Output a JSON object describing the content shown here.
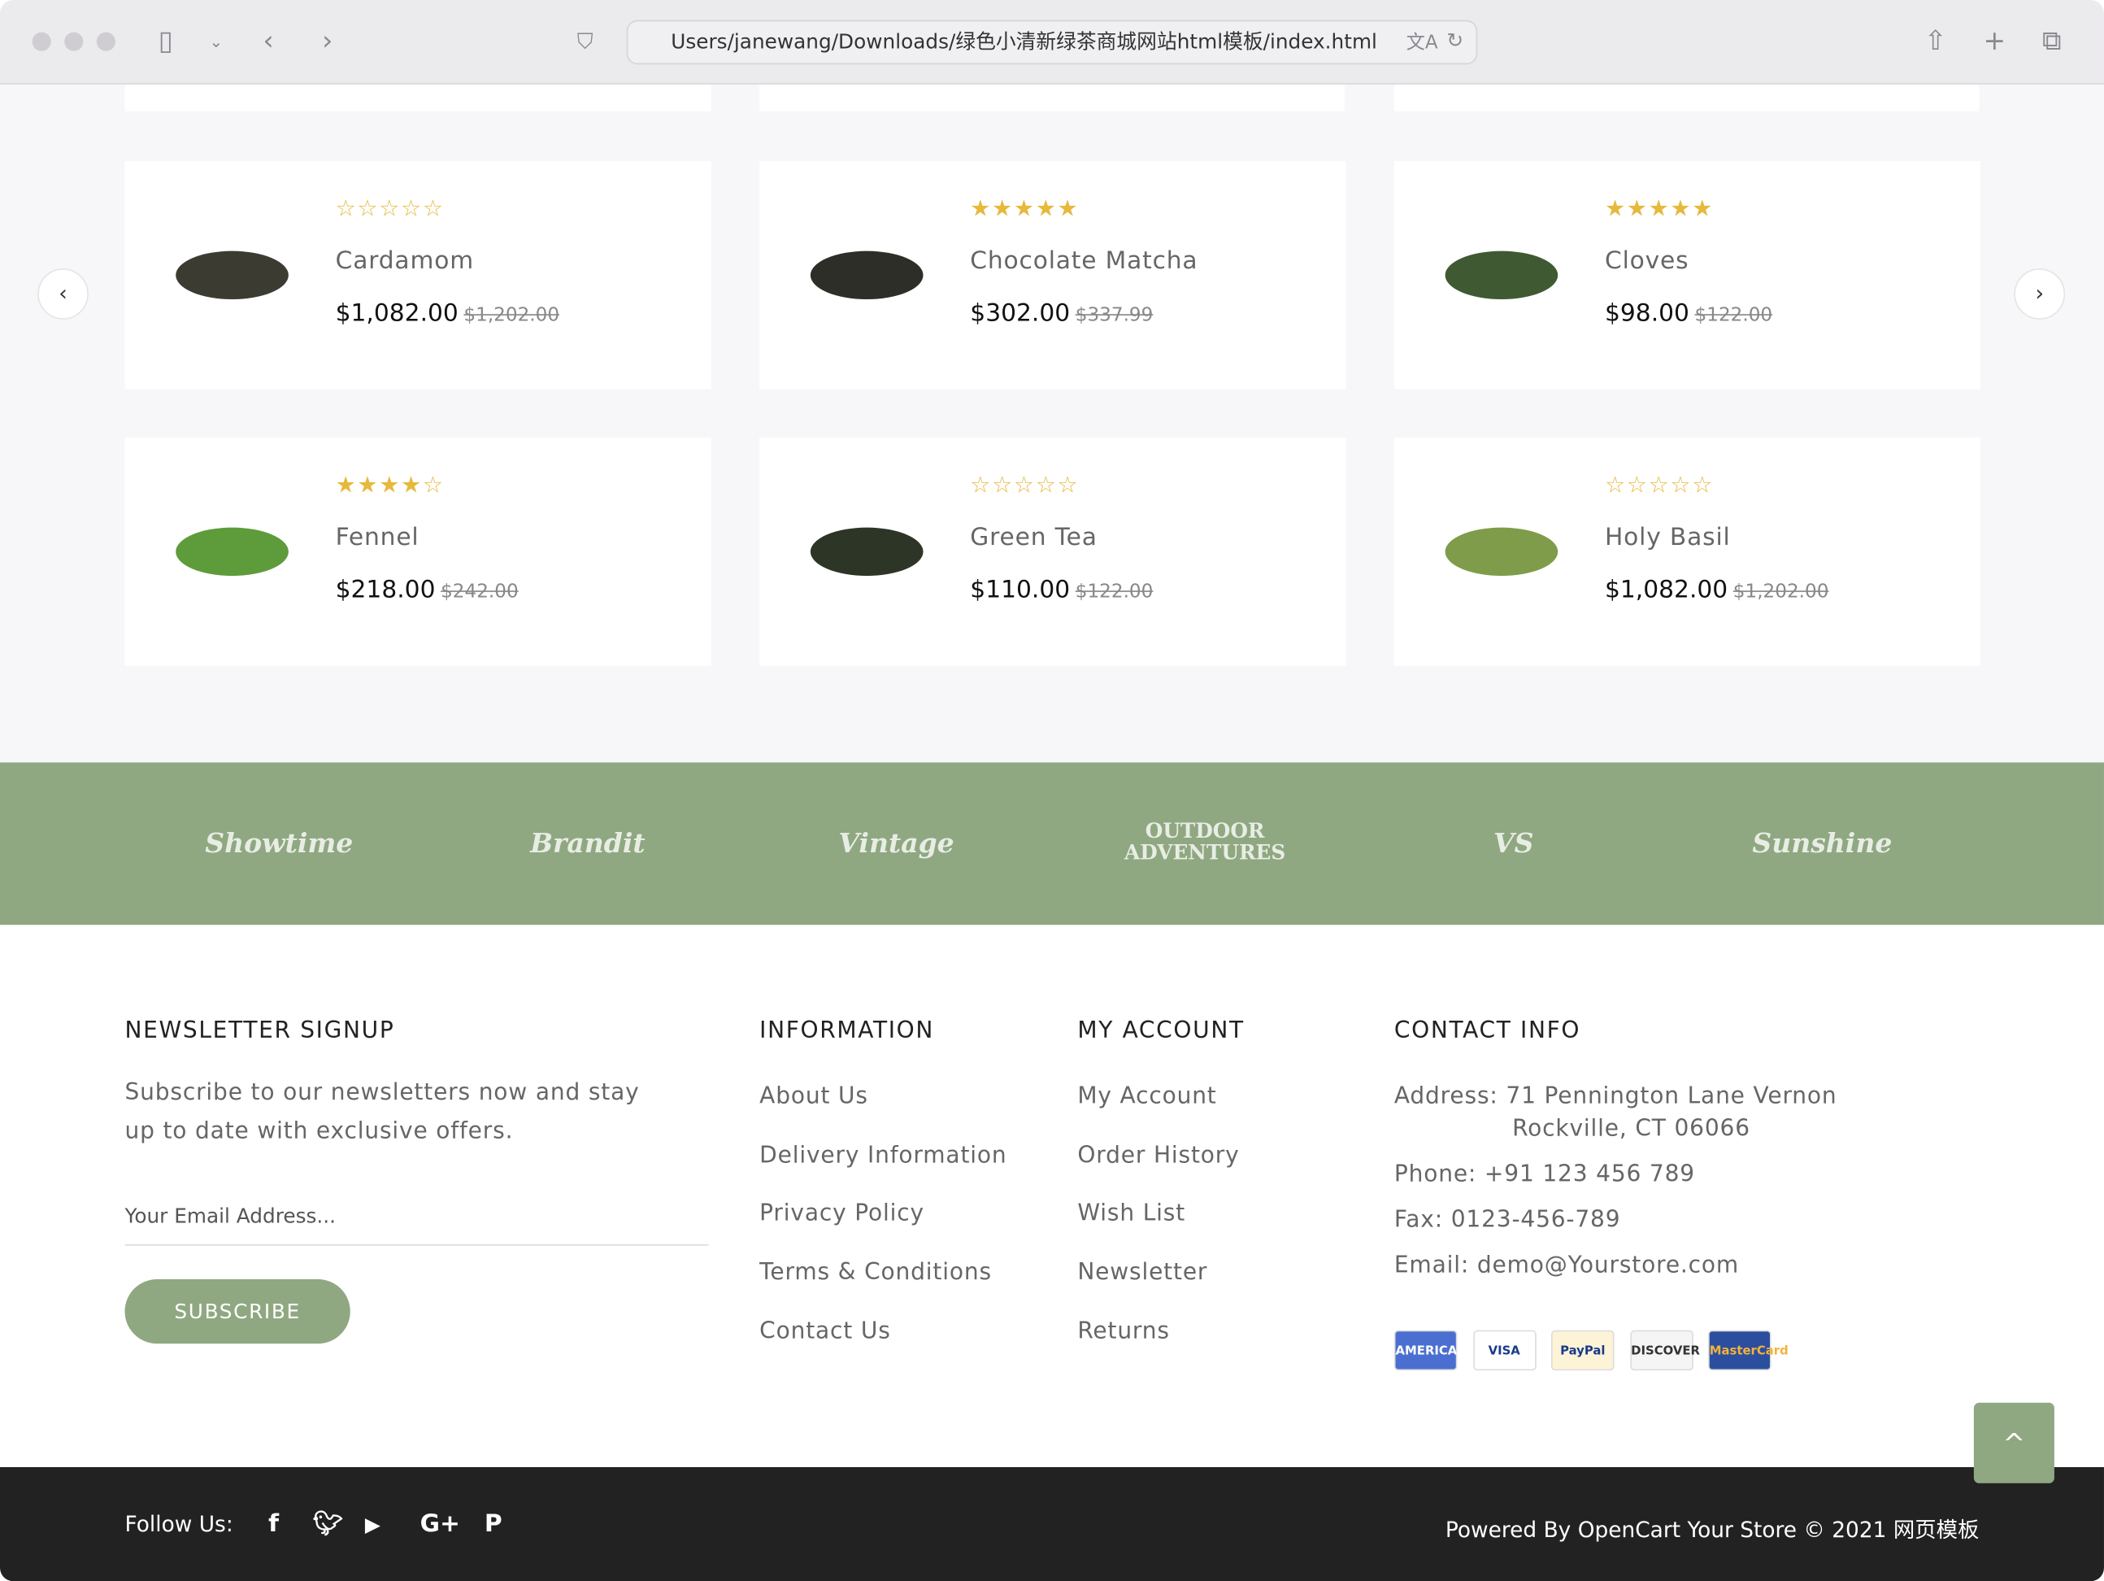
{
  "browser": {
    "url": "Users/janewang/Downloads/绿色小清新绿茶商城网站html模板/index.html"
  },
  "products": [
    {
      "name": "Cardamom",
      "price": "$1,082.00",
      "old_price": "$1,202.00",
      "rating": 0
    },
    {
      "name": "Chocolate Matcha",
      "price": "$302.00",
      "old_price": "$337.99",
      "rating": 5
    },
    {
      "name": "Cloves",
      "price": "$98.00",
      "old_price": "$122.00",
      "rating": 5
    },
    {
      "name": "Fennel",
      "price": "$218.00",
      "old_price": "$242.00",
      "rating": 4
    },
    {
      "name": "Green Tea",
      "price": "$110.00",
      "old_price": "$122.00",
      "rating": 0
    },
    {
      "name": "Holy Basil",
      "price": "$1,082.00",
      "old_price": "$1,202.00",
      "rating": 0
    }
  ],
  "brands": [
    "Showtime",
    "Brandit",
    "Vintage",
    "Outdoor Adventures",
    "VS",
    "Sunshine"
  ],
  "newsletter": {
    "title": "NEWSLETTER SIGNUP",
    "text1": "Subscribe to our newsletters now and stay",
    "text2": "up to date with exclusive offers.",
    "placeholder": "Your Email Address...",
    "button": "SUBSCRIBE"
  },
  "information": {
    "title": "INFORMATION",
    "links": [
      "About Us",
      "Delivery Information",
      "Privacy Policy",
      "Terms & Conditions",
      "Contact Us"
    ]
  },
  "account": {
    "title": "MY ACCOUNT",
    "links": [
      "My Account",
      "Order History",
      "Wish List",
      "Newsletter",
      "Returns"
    ]
  },
  "contact": {
    "title": "CONTACT INFO",
    "address1": "Address: 71 Pennington Lane Vernon",
    "address2": "Rockville, CT 06066",
    "phone": "Phone: +91 123 456 789",
    "fax": "Fax: 0123-456-789",
    "email": "Email: demo@Yourstore.com"
  },
  "payments": [
    "AMERICAN EXPRESS",
    "VISA",
    "PayPal",
    "DISCOVER",
    "MasterCard"
  ],
  "bottom": {
    "follow": "Follow Us:",
    "copyright": "Powered By OpenCart Your Store © 2021 网页模板"
  },
  "colors": {
    "accent": "#8fa882",
    "star": "#e6b93d",
    "bottom_bar": "#222222"
  }
}
